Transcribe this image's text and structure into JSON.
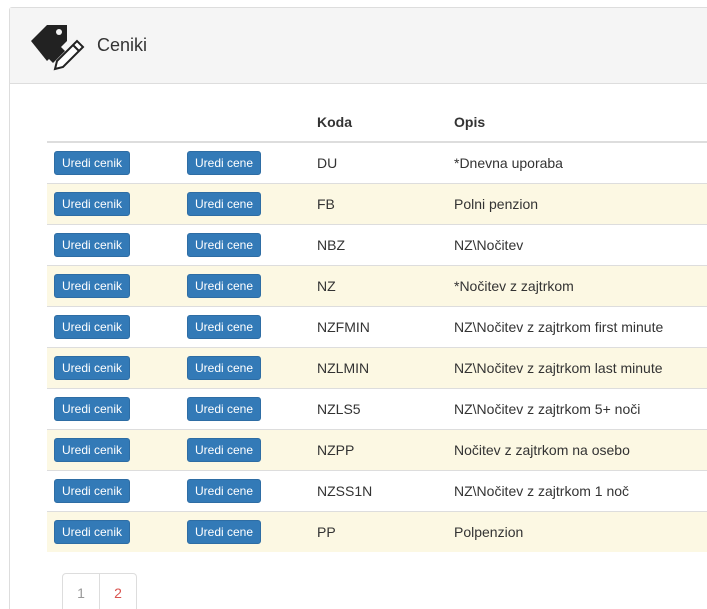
{
  "panel": {
    "title": "Ceniki",
    "icon": "tag-edit-icon"
  },
  "table": {
    "headers": [
      "",
      "",
      "Koda",
      "Opis"
    ],
    "rows": [
      {
        "edit_pricelist": "Uredi cenik",
        "edit_prices": "Uredi cene",
        "code": "DU",
        "description": "*Dnevna uporaba"
      },
      {
        "edit_pricelist": "Uredi cenik",
        "edit_prices": "Uredi cene",
        "code": "FB",
        "description": "Polni penzion"
      },
      {
        "edit_pricelist": "Uredi cenik",
        "edit_prices": "Uredi cene",
        "code": "NBZ",
        "description": "NZ\\Nočitev"
      },
      {
        "edit_pricelist": "Uredi cenik",
        "edit_prices": "Uredi cene",
        "code": "NZ",
        "description": "*Nočitev z zajtrkom"
      },
      {
        "edit_pricelist": "Uredi cenik",
        "edit_prices": "Uredi cene",
        "code": "NZFMIN",
        "description": "NZ\\Nočitev z zajtrkom first minute"
      },
      {
        "edit_pricelist": "Uredi cenik",
        "edit_prices": "Uredi cene",
        "code": "NZLMIN",
        "description": "NZ\\Nočitev z zajtrkom last minute"
      },
      {
        "edit_pricelist": "Uredi cenik",
        "edit_prices": "Uredi cene",
        "code": "NZLS5",
        "description": "NZ\\Nočitev z zajtrkom 5+ noči"
      },
      {
        "edit_pricelist": "Uredi cenik",
        "edit_prices": "Uredi cene",
        "code": "NZPP",
        "description": "Nočitev z zajtrkom na osebo"
      },
      {
        "edit_pricelist": "Uredi cenik",
        "edit_prices": "Uredi cene",
        "code": "NZSS1N",
        "description": "NZ\\Nočitev z zajtrkom 1 noč"
      },
      {
        "edit_pricelist": "Uredi cenik",
        "edit_prices": "Uredi cene",
        "code": "PP",
        "description": "Polpenzion"
      }
    ]
  },
  "pagination": {
    "pages": [
      "1",
      "2"
    ],
    "current": "1"
  },
  "colors": {
    "button": "#337ab7",
    "stripe": "#fcf8e3",
    "page_link": "#d9534f"
  }
}
